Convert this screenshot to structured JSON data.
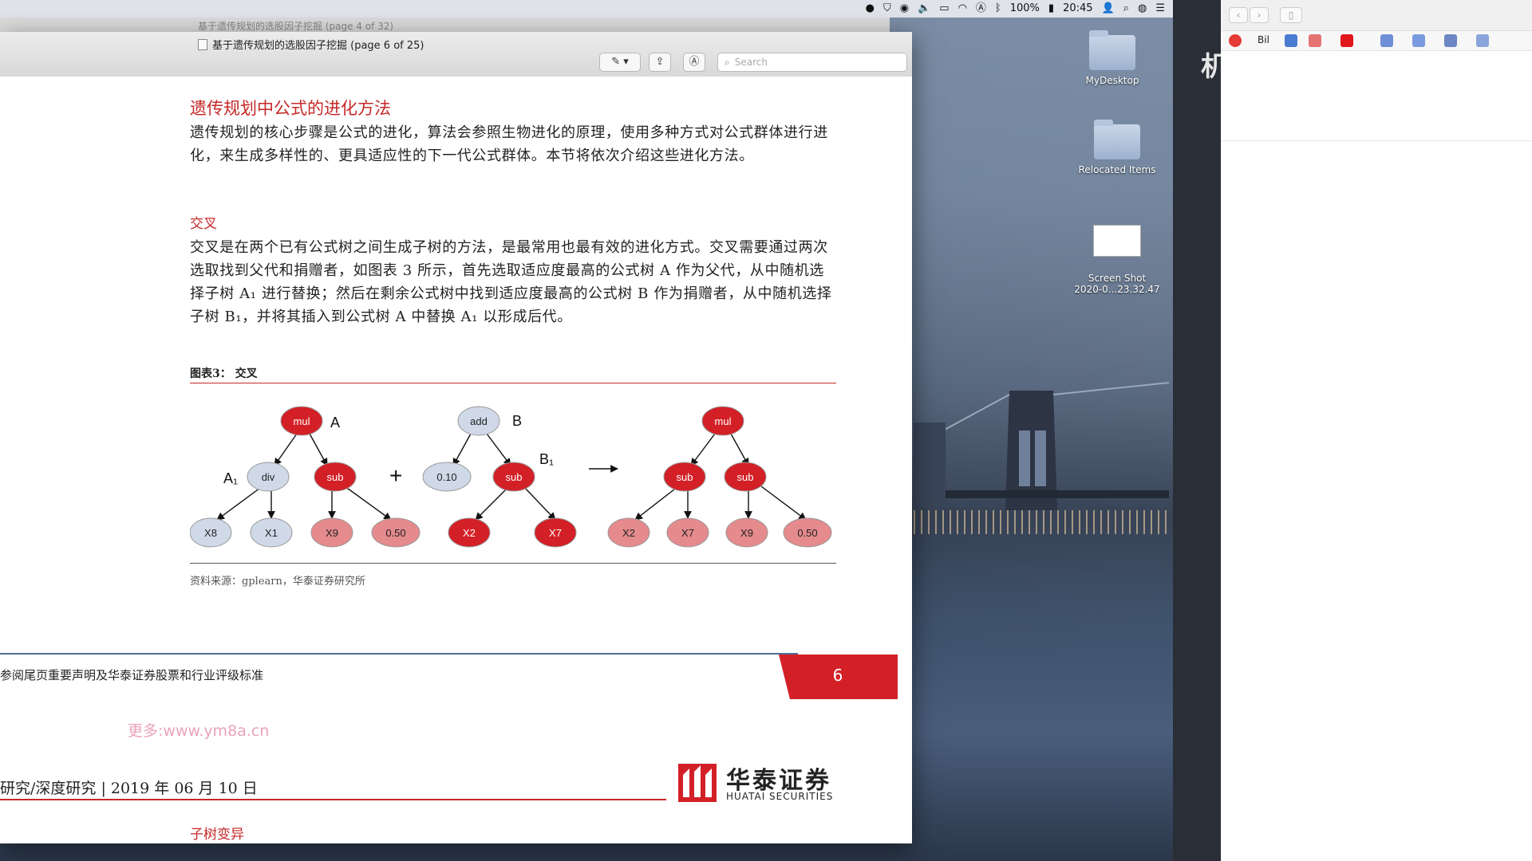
{
  "menubar": {
    "battery": "100%",
    "clock": "20:45",
    "items": [
      "bear-icon",
      "shield-icon",
      "wechat-icon",
      "volume-icon",
      "display-icon",
      "wifi-icon",
      "a-icon",
      "bluetooth-icon",
      "battery-icon",
      "user-icon",
      "spotlight-icon",
      "siri-icon",
      "list-icon"
    ]
  },
  "back_window": {
    "title": "基于遗传规划的选股因子挖掘 (page 4 of 32)"
  },
  "preview": {
    "title": "基于遗传规划的选股因子挖掘 (page 6 of 25)",
    "search_placeholder": "Search"
  },
  "page": {
    "section_title": "遗传规划中公式的进化方法",
    "intro": "遗传规划的核心步骤是公式的进化，算法会参照生物进化的原理，使用多种方式对公式群体进行进化，来生成多样性的、更具适应性的下一代公式群体。本节将依次介绍这些进化方法。",
    "sub_title": "交叉",
    "crossover_para": "交叉是在两个已有公式树之间生成子树的方法，是最常用也最有效的进化方式。交叉需要通过两次选取找到父代和捐赠者，如图表 3 所示，首先选取适应度最高的公式树 A 作为父代，从中随机选择子树 A₁ 进行替换；然后在剩余公式树中找到适应度最高的公式树 B 作为捐赠者，从中随机选择子树 B₁，并将其插入到公式树 A 中替换 A₁ 以形成后代。",
    "figure_title": "图表3：   交叉",
    "source": "资料来源：gplearn，华泰证券研究所",
    "footer_note": "参阅尾页重要声明及华泰证券股票和行业评级标准",
    "page_number": "6",
    "watermark": "更多:www.ym8a.cn",
    "next_page_header": "研究/深度研究  | 2019 年 06 月 10 日",
    "logo_cn": "华泰证券",
    "logo_en": "HUATAI SECURITIES",
    "next_subtitle": "子树变异"
  },
  "figure": {
    "label_A": "A",
    "label_A1": "A₁",
    "label_B": "B",
    "label_B1": "B₁",
    "plus": "+",
    "arrow": "→",
    "tree_A": {
      "root": "mul",
      "left": "div",
      "right": "sub",
      "ll": "X8",
      "lr": "X1",
      "rl": "X9",
      "rr": "0.50"
    },
    "tree_B": {
      "root": "add",
      "left": "0.10",
      "right": "sub",
      "rl": "X2",
      "rr": "X7"
    },
    "tree_C": {
      "root": "mul",
      "left": "sub",
      "right": "sub",
      "ll": "X2",
      "lr": "X7",
      "rl": "X9",
      "rr": "0.50"
    }
  },
  "desktop": {
    "items": [
      {
        "label": "MyDesktop"
      },
      {
        "label": "Relocated Items"
      },
      {
        "label": "Screen Shot\n2020-0...23.32.47"
      }
    ]
  },
  "browser": {
    "bookmark_text": "Bil",
    "side_char": "机"
  },
  "colors": {
    "accent_red": "#c62828",
    "node_red": "#d32027",
    "node_blue": "#cfd9e8"
  }
}
